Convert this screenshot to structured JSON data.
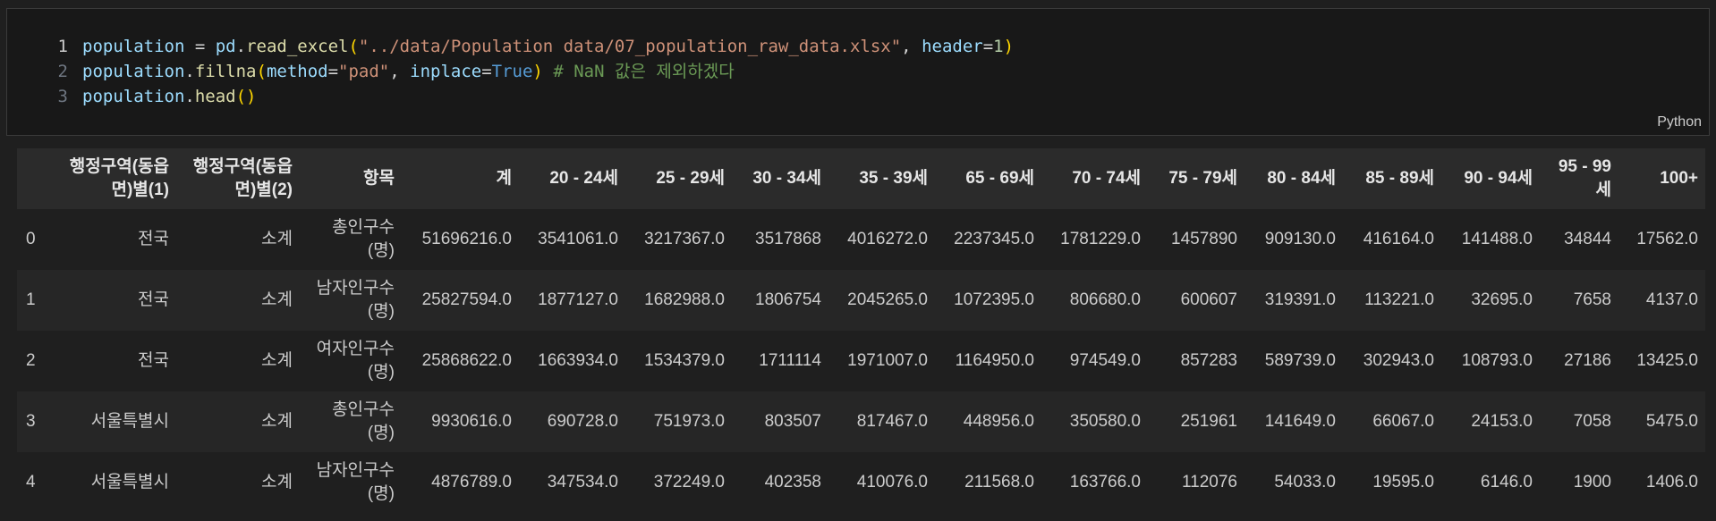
{
  "cell": {
    "lines": [
      {
        "number": "1",
        "active": true,
        "tokens": [
          {
            "t": "var",
            "v": "population"
          },
          {
            "t": "op",
            "v": " = "
          },
          {
            "t": "var",
            "v": "pd"
          },
          {
            "t": "op",
            "v": "."
          },
          {
            "t": "fn",
            "v": "read_excel"
          },
          {
            "t": "par",
            "v": "("
          },
          {
            "t": "str",
            "v": "\"../data/Population data/07_population_raw_data.xlsx\""
          },
          {
            "t": "op",
            "v": ", "
          },
          {
            "t": "var",
            "v": "header"
          },
          {
            "t": "op",
            "v": "="
          },
          {
            "t": "num",
            "v": "1"
          },
          {
            "t": "par",
            "v": ")"
          }
        ]
      },
      {
        "number": "2",
        "active": false,
        "tokens": [
          {
            "t": "var",
            "v": "population"
          },
          {
            "t": "op",
            "v": "."
          },
          {
            "t": "fn",
            "v": "fillna"
          },
          {
            "t": "par",
            "v": "("
          },
          {
            "t": "var",
            "v": "method"
          },
          {
            "t": "op",
            "v": "="
          },
          {
            "t": "str",
            "v": "\"pad\""
          },
          {
            "t": "op",
            "v": ", "
          },
          {
            "t": "var",
            "v": "inplace"
          },
          {
            "t": "op",
            "v": "="
          },
          {
            "t": "kw",
            "v": "True"
          },
          {
            "t": "par",
            "v": ")"
          },
          {
            "t": "op",
            "v": " "
          },
          {
            "t": "com",
            "v": "# NaN 값은 제외하겠다"
          }
        ]
      },
      {
        "number": "3",
        "active": false,
        "tokens": [
          {
            "t": "var",
            "v": "population"
          },
          {
            "t": "op",
            "v": "."
          },
          {
            "t": "fn",
            "v": "head"
          },
          {
            "t": "par",
            "v": "()"
          }
        ]
      }
    ],
    "language": "Python"
  },
  "output": {
    "columns": [
      "",
      "행정구역(동읍면)별(1)",
      "행정구역(동읍면)별(2)",
      "항목",
      "계",
      "20 - 24세",
      "25 - 29세",
      "30 - 34세",
      "35 - 39세",
      "65 - 69세",
      "70 - 74세",
      "75 - 79세",
      "80 - 84세",
      "85 - 89세",
      "90 - 94세",
      "95 - 99세",
      "100+"
    ],
    "rows": [
      [
        "0",
        "전국",
        "소계",
        "총인구수 (명)",
        "51696216.0",
        "3541061.0",
        "3217367.0",
        "3517868",
        "4016272.0",
        "2237345.0",
        "1781229.0",
        "1457890",
        "909130.0",
        "416164.0",
        "141488.0",
        "34844",
        "17562.0"
      ],
      [
        "1",
        "전국",
        "소계",
        "남자인구수 (명)",
        "25827594.0",
        "1877127.0",
        "1682988.0",
        "1806754",
        "2045265.0",
        "1072395.0",
        "806680.0",
        "600607",
        "319391.0",
        "113221.0",
        "32695.0",
        "7658",
        "4137.0"
      ],
      [
        "2",
        "전국",
        "소계",
        "여자인구수 (명)",
        "25868622.0",
        "1663934.0",
        "1534379.0",
        "1711114",
        "1971007.0",
        "1164950.0",
        "974549.0",
        "857283",
        "589739.0",
        "302943.0",
        "108793.0",
        "27186",
        "13425.0"
      ],
      [
        "3",
        "서울특별시",
        "소계",
        "총인구수 (명)",
        "9930616.0",
        "690728.0",
        "751973.0",
        "803507",
        "817467.0",
        "448956.0",
        "350580.0",
        "251961",
        "141649.0",
        "66067.0",
        "24153.0",
        "7058",
        "5475.0"
      ],
      [
        "4",
        "서울특별시",
        "소계",
        "남자인구수 (명)",
        "4876789.0",
        "347534.0",
        "372249.0",
        "402358",
        "410076.0",
        "211568.0",
        "163766.0",
        "112076",
        "54033.0",
        "19595.0",
        "6146.0",
        "1900",
        "1406.0"
      ]
    ]
  }
}
